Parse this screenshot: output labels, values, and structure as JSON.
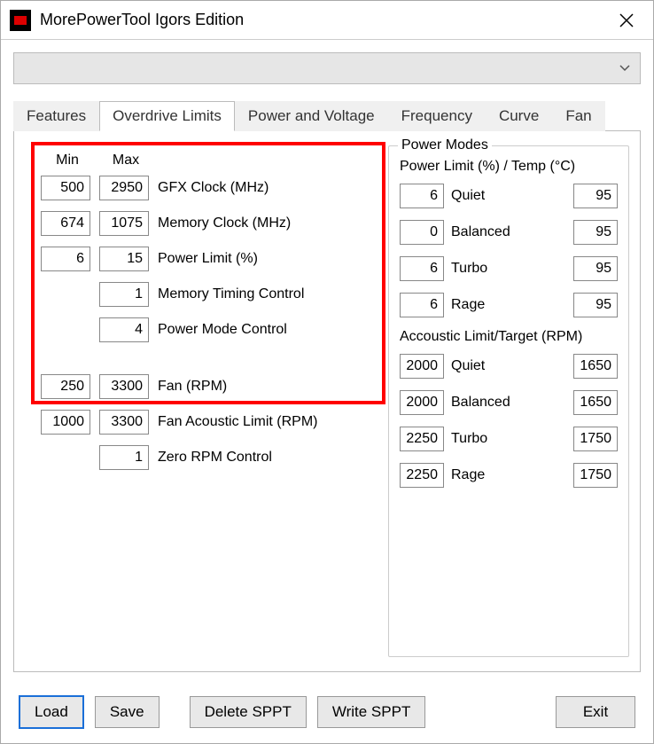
{
  "window": {
    "title": "MorePowerTool Igors Edition"
  },
  "tabs": {
    "features": "Features",
    "overdrive": "Overdrive Limits",
    "power_voltage": "Power and Voltage",
    "frequency": "Frequency",
    "curve": "Curve",
    "fan": "Fan"
  },
  "overdrive": {
    "headers": {
      "min": "Min",
      "max": "Max"
    },
    "rows": [
      {
        "min": "500",
        "max": "2950",
        "label": "GFX Clock (MHz)"
      },
      {
        "min": "674",
        "max": "1075",
        "label": "Memory Clock (MHz)"
      },
      {
        "min": "6",
        "max": "15",
        "label": "Power Limit (%)"
      },
      {
        "min": "",
        "max": "1",
        "label": "Memory Timing Control"
      },
      {
        "min": "",
        "max": "4",
        "label": "Power Mode Control"
      }
    ],
    "rows2": [
      {
        "min": "250",
        "max": "3300",
        "label": "Fan (RPM)"
      },
      {
        "min": "1000",
        "max": "3300",
        "label": "Fan Acoustic Limit (RPM)"
      },
      {
        "min": "",
        "max": "1",
        "label": "Zero RPM Control"
      }
    ]
  },
  "power_modes": {
    "frame_title": "Power Modes",
    "section1_label": "Power Limit (%) / Temp (°C)",
    "section1": [
      {
        "a": "6",
        "label": "Quiet",
        "b": "95"
      },
      {
        "a": "0",
        "label": "Balanced",
        "b": "95"
      },
      {
        "a": "6",
        "label": "Turbo",
        "b": "95"
      },
      {
        "a": "6",
        "label": "Rage",
        "b": "95"
      }
    ],
    "section2_label": "Accoustic Limit/Target (RPM)",
    "section2": [
      {
        "a": "2000",
        "label": "Quiet",
        "b": "1650"
      },
      {
        "a": "2000",
        "label": "Balanced",
        "b": "1650"
      },
      {
        "a": "2250",
        "label": "Turbo",
        "b": "1750"
      },
      {
        "a": "2250",
        "label": "Rage",
        "b": "1750"
      }
    ]
  },
  "buttons": {
    "load": "Load",
    "save": "Save",
    "delete_sppt": "Delete SPPT",
    "write_sppt": "Write SPPT",
    "exit": "Exit"
  }
}
